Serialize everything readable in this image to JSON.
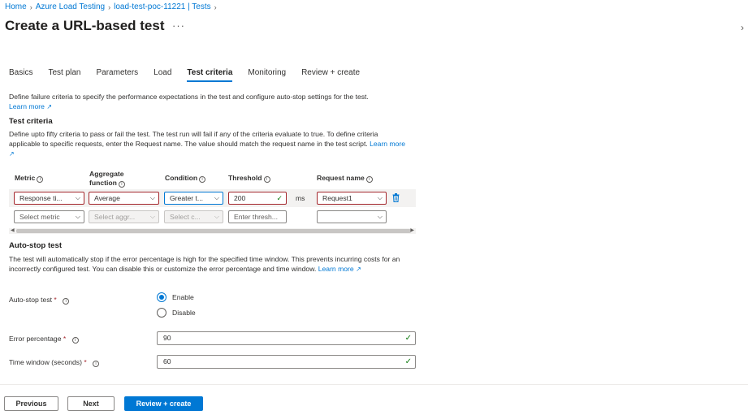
{
  "breadcrumb": [
    "Home",
    "Azure Load Testing",
    "load-test-poc-11221 | Tests"
  ],
  "page_title": "Create a URL-based test",
  "more": "···",
  "tabs": [
    {
      "label": "Basics"
    },
    {
      "label": "Test plan"
    },
    {
      "label": "Parameters"
    },
    {
      "label": "Load"
    },
    {
      "label": "Test criteria",
      "active": true
    },
    {
      "label": "Monitoring"
    },
    {
      "label": "Review + create"
    }
  ],
  "intro": {
    "text": "Define failure criteria to specify the performance expectations in the test and configure auto-stop settings for the test.",
    "learn_more": "Learn more"
  },
  "test_criteria": {
    "title": "Test criteria",
    "description": "Define upto fifty criteria to pass or fail the test. The test run will fail if any of the criteria evaluate to true. To define criteria applicable to specific requests, enter the Request name. The value should match the request name in the test script.",
    "learn_more": "Learn more",
    "headers": {
      "metric": "Metric",
      "aggregate_1": "Aggregate",
      "aggregate_2": "function",
      "condition": "Condition",
      "threshold": "Threshold",
      "request_name": "Request name"
    },
    "rows": [
      {
        "metric": "Response ti...",
        "aggregate": "Average",
        "condition": "Greater t...",
        "threshold": "200",
        "unit": "ms",
        "request": "Request1"
      },
      {
        "metric": "Select metric",
        "aggregate": "Select aggr...",
        "condition": "Select c...",
        "threshold": "Enter thresh...",
        "unit": "",
        "request": ""
      }
    ]
  },
  "auto_stop": {
    "title": "Auto-stop test",
    "description": "The test will automatically stop if the error percentage is high for the specified time window. This prevents incurring costs for an incorrectly configured test. You can disable this or customize the error percentage and time window.",
    "learn_more": "Learn more",
    "toggle_label": "Auto-stop test",
    "options": [
      "Enable",
      "Disable"
    ],
    "selected": "Enable",
    "error_label": "Error percentage",
    "error_value": "90",
    "window_label": "Time window (seconds)",
    "window_value": "60"
  },
  "footer": {
    "previous": "Previous",
    "next": "Next",
    "review": "Review + create"
  },
  "colors": {
    "accent": "#0078d4",
    "error_border": "#a4262c",
    "success": "#107c10"
  },
  "icons": [
    "chevron-right-icon",
    "info-icon",
    "external-link-icon",
    "chevron-down-icon",
    "delete-icon",
    "check-icon"
  ]
}
